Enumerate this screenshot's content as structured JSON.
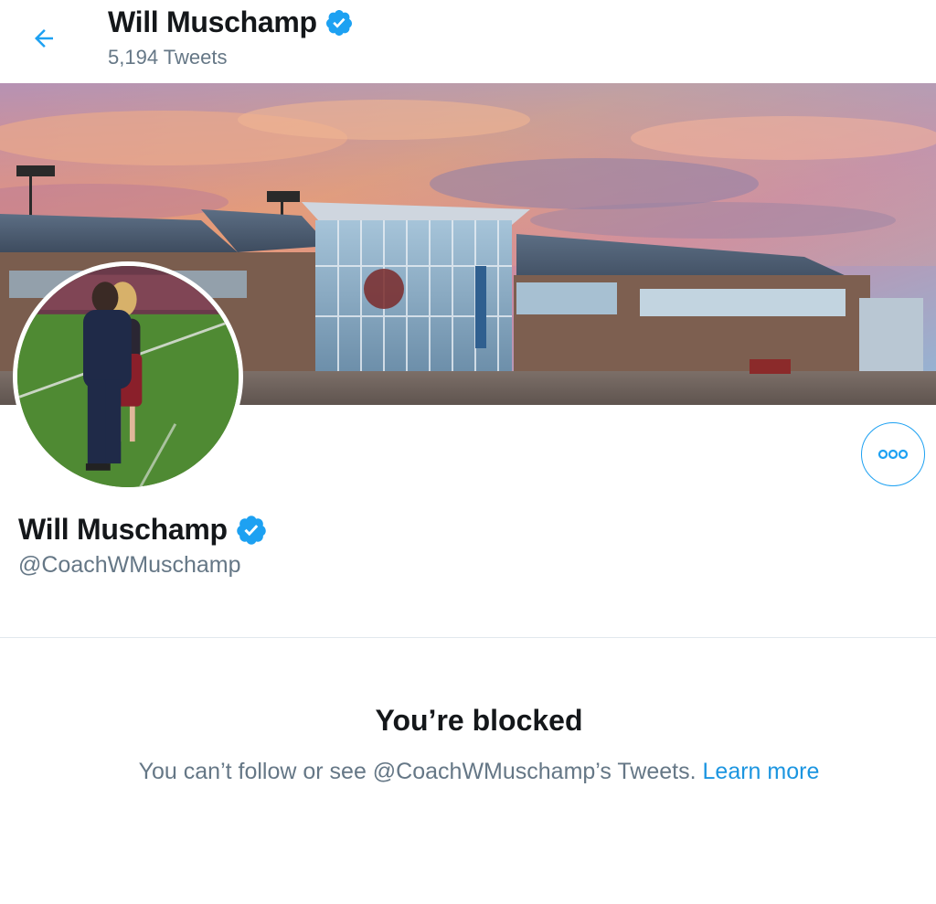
{
  "header": {
    "back_icon": "arrow-left-icon",
    "title": "Will Muschamp",
    "tweet_count": "5,194 Tweets"
  },
  "profile": {
    "name": "Will Muschamp",
    "handle": "@CoachWMuschamp",
    "verified_icon": "verified-badge-icon",
    "more_icon": "more-options-icon"
  },
  "blocked": {
    "title": "You’re blocked",
    "message": "You can’t follow or see @CoachWMuschamp’s Tweets.",
    "link_label": "Learn more"
  },
  "colors": {
    "accent": "#1da1f2",
    "link": "#1b95e0",
    "secondary_text": "#657786",
    "primary_text": "#14171a",
    "divider": "#e1e8ed"
  }
}
